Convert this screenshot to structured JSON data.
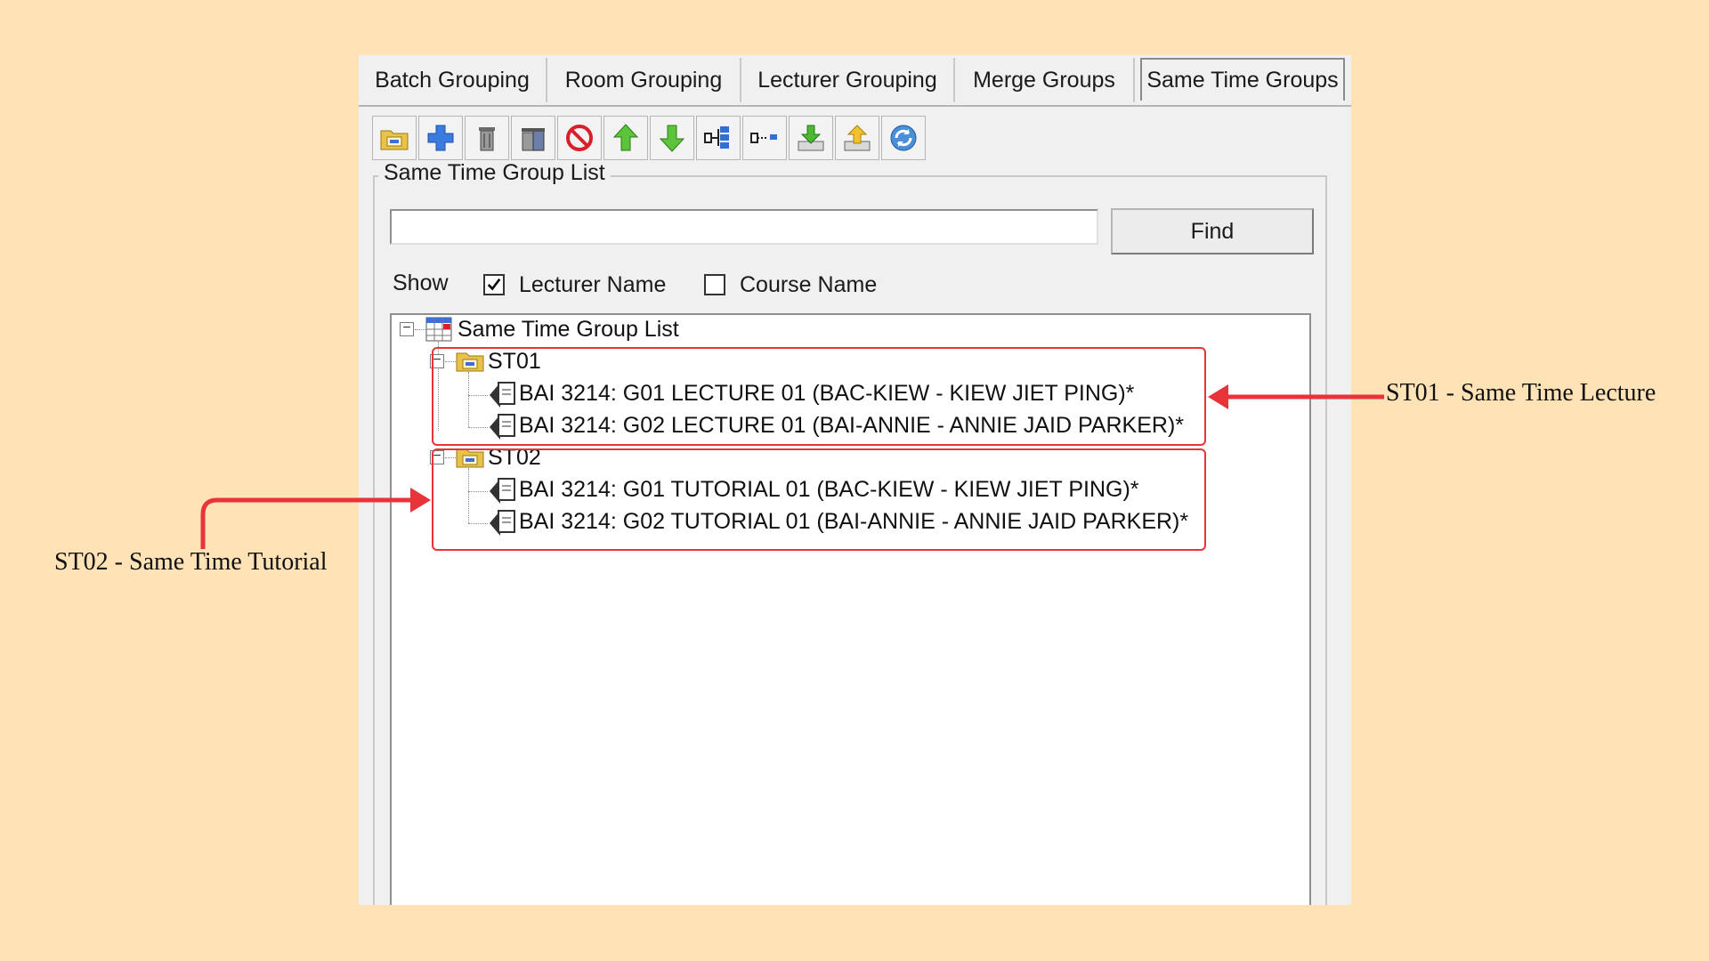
{
  "tabs": [
    {
      "label": "Batch Grouping"
    },
    {
      "label": "Room Grouping"
    },
    {
      "label": "Lecturer Grouping"
    },
    {
      "label": "Merge Groups"
    },
    {
      "label": "Same Time Groups"
    }
  ],
  "toolbar": {
    "buttons": [
      {
        "icon": "open-folder-icon"
      },
      {
        "icon": "add-icon"
      },
      {
        "icon": "remove-icon"
      },
      {
        "icon": "remove-all-icon"
      },
      {
        "icon": "stop-icon"
      },
      {
        "icon": "arrow-up-icon"
      },
      {
        "icon": "arrow-down-icon"
      },
      {
        "icon": "expand-icon"
      },
      {
        "icon": "collapse-icon"
      },
      {
        "icon": "import-icon"
      },
      {
        "icon": "export-icon"
      },
      {
        "icon": "refresh-icon"
      }
    ]
  },
  "panel": {
    "title": "Same Time Group List",
    "search_value": "",
    "find_label": "Find",
    "show_label": "Show",
    "lecturer_name_label": "Lecturer Name",
    "lecturer_name_checked": true,
    "course_name_label": "Course Name",
    "course_name_checked": false
  },
  "tree": {
    "root": "Same Time Group List",
    "groups": [
      {
        "name": "ST01",
        "items": [
          "BAI 3214: G01 LECTURE  01 (BAC-KIEW - KIEW JIET PING)*",
          "BAI 3214: G02 LECTURE 01 (BAI-ANNIE - ANNIE JAID PARKER)*"
        ]
      },
      {
        "name": "ST02",
        "items": [
          "BAI 3214: G01 TUTORIAL 01 (BAC-KIEW - KIEW JIET PING)*",
          "BAI 3214: G02 TUTORIAL  01 (BAI-ANNIE - ANNIE JAID PARKER)*"
        ]
      }
    ]
  },
  "annotations": {
    "st01": "ST01 - Same Time Lecture",
    "st02": "ST02 - Same Time Tutorial",
    "color": "#e8333a"
  }
}
